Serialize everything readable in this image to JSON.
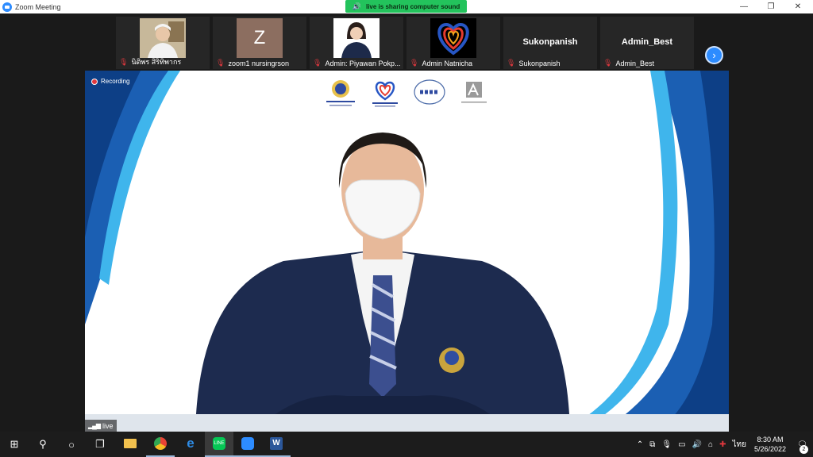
{
  "window": {
    "title": "Zoom Meeting"
  },
  "share_banner": {
    "text": "live is sharing computer sound"
  },
  "participants": [
    {
      "name": "นิติพร สิริทิพากร"
    },
    {
      "name": "zoom1 nursingrson",
      "initial": "Z"
    },
    {
      "name": "Admin: Piyawan Pokp..."
    },
    {
      "name": "Admin Natnicha"
    },
    {
      "name": "Sukonpanish",
      "label": "Sukonpanish"
    },
    {
      "name": "Admin_Best",
      "label": "Admin_Best"
    }
  ],
  "stage": {
    "recording_label": "Recording",
    "live_label": "live"
  },
  "taskbar": {
    "clock_time": "8:30 AM",
    "clock_date": "5/26/2022",
    "language": "ไทย",
    "notification_count": "2"
  },
  "colors": {
    "zoom_blue": "#2d8cff",
    "share_green": "#23c35c",
    "muted_red": "#e0383e"
  }
}
